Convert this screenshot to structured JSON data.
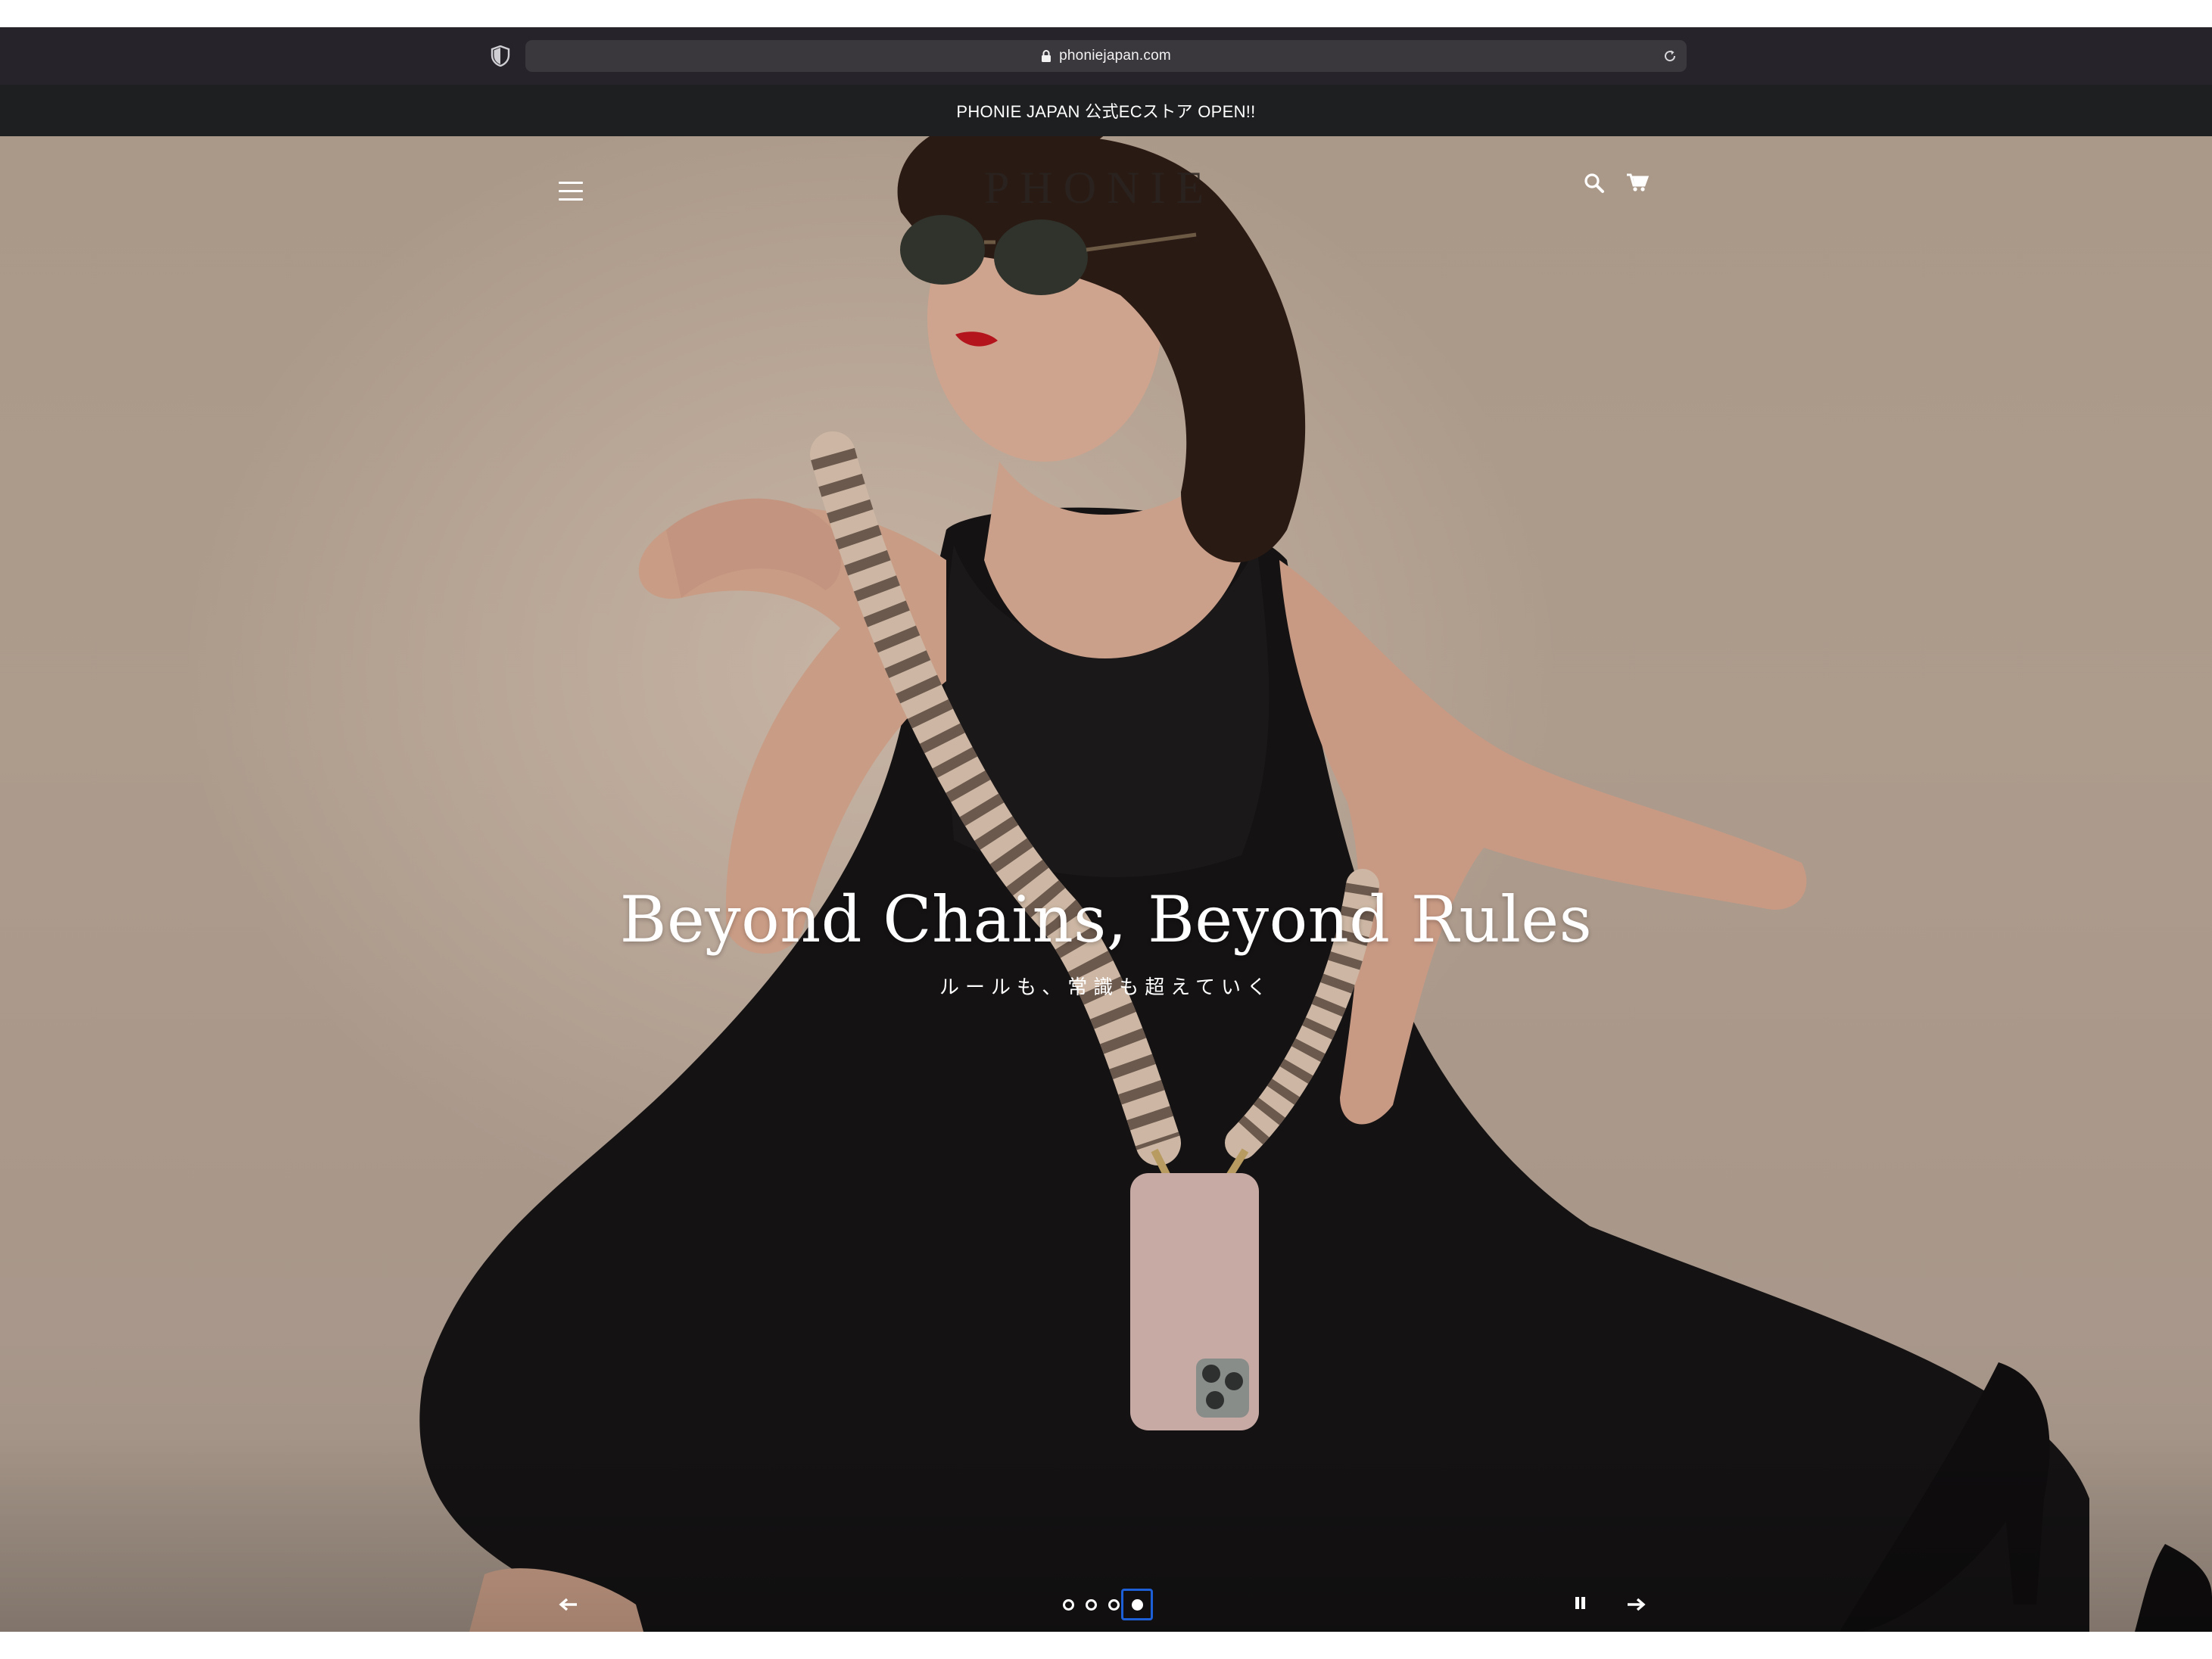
{
  "browser": {
    "url": "phoniejapan.com",
    "icons": [
      "shield-icon",
      "lock-icon",
      "reload-icon"
    ]
  },
  "announcement": {
    "text": "PHONIE JAPAN 公式ECストア OPEN!!"
  },
  "header": {
    "logo": "PHONIE",
    "icons": [
      "menu-icon",
      "search-icon",
      "cart-icon"
    ]
  },
  "hero": {
    "title": "Beyond Chains, Beyond Rules",
    "subtitle": "ルールも、常識も超えていく",
    "slides_total": 4,
    "active_slide": 4,
    "controls": [
      "prev-arrow-icon",
      "pause-icon",
      "next-arrow-icon"
    ]
  },
  "colors": {
    "browser_bar": "#26232a",
    "announcement_bg": "#1d1f20",
    "hero_bg": "#ad9b8c",
    "focus_ring": "#1c5fd6"
  }
}
